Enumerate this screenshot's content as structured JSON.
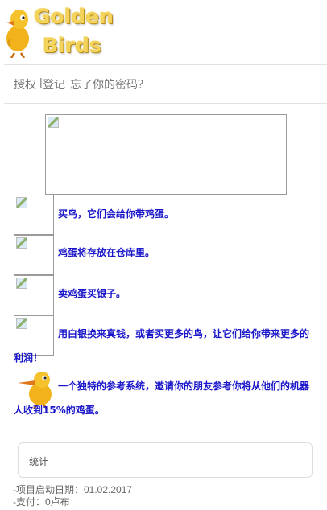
{
  "logo": {
    "line1": "Golden",
    "line2": "Birds"
  },
  "nav": {
    "login": "授权",
    "separator": "|",
    "register": "登记",
    "forgot": "忘了你的密码？"
  },
  "promo": {
    "item1": "买鸟，它们会给你带鸡蛋。",
    "item2": "鸡蛋将存放在仓库里。",
    "item3": "卖鸡蛋买银子。",
    "item4": "用白银换来真钱，或者买更多的鸟，让它们给你带来更多的利润！",
    "referral": "一个独特的参考系统，邀请你的朋友参考你将从他们的机器人收到15%的鸡蛋。"
  },
  "stats": {
    "title": "统计",
    "start_date": "-项目启动日期：01.02.2017",
    "paid": "-支付：0卢布"
  },
  "colors": {
    "logo_gold": "#f4d35a",
    "promo_text": "#1a16c9"
  }
}
